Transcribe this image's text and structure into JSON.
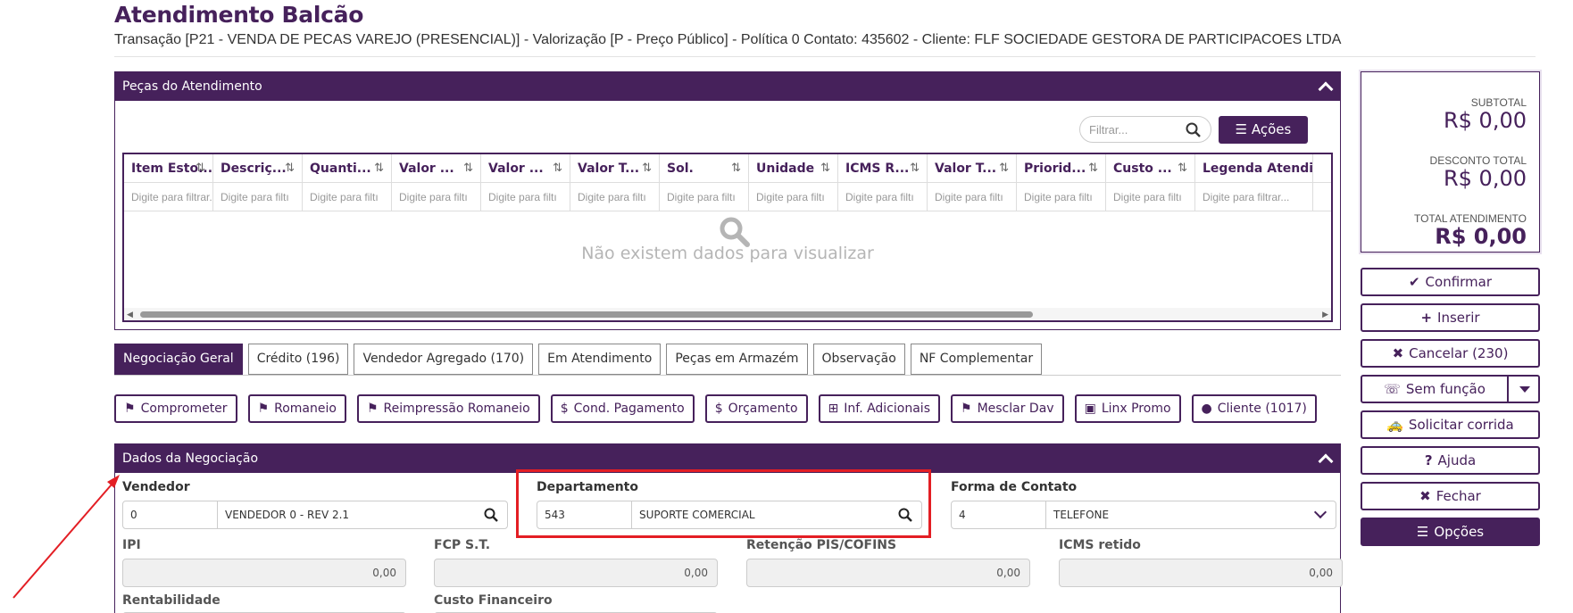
{
  "header": {
    "title": "Atendimento Balcão",
    "subtitle": "Transação [P21 - VENDA DE PECAS VAREJO (PRESENCIAL)] - Valorização [P - Preço Público] - Política 0 Contato: 435602 - Cliente: FLF SOCIEDADE GESTORA DE PARTICIPACOES LTDA"
  },
  "pecas": {
    "title": "Peças do Atendimento",
    "filter_placeholder": "Filtrar...",
    "acoes_label": "Ações",
    "columns": [
      "Item Esto...",
      "Descriç...",
      "Quanti...",
      "Valor ...",
      "Valor ...",
      "Valor T...",
      "Sol.",
      "Unidade",
      "ICMS R...",
      "Valor T...",
      "Priorid...",
      "Custo ...",
      "Legenda Atendime"
    ],
    "column_filters": [
      "Digite para filtrar...",
      "Digite para filtı",
      "Digite para filtı",
      "Digite para filtı",
      "Digite para filtı",
      "Digite para filtı",
      "Digite para filtı",
      "Digite para filtı",
      "Digite para filtı",
      "Digite para filtı",
      "Digite para filtı",
      "Digite para filtı",
      "Digite para filtrar..."
    ],
    "empty_text": "Não existem dados para visualizar"
  },
  "tabs": [
    "Negociação Geral",
    "Crédito (196)",
    "Vendedor Agregado (170)",
    "Em Atendimento",
    "Peças em Armazém",
    "Observação",
    "NF Complementar"
  ],
  "actions": [
    {
      "label": "Comprometer",
      "icon": "flag-icon"
    },
    {
      "label": "Romaneio",
      "icon": "flag-icon"
    },
    {
      "label": "Reimpressão Romaneio",
      "icon": "flag-icon"
    },
    {
      "label": "Cond. Pagamento",
      "icon": "dollar-icon"
    },
    {
      "label": "Orçamento",
      "icon": "dollar-icon"
    },
    {
      "label": "Inf. Adicionais",
      "icon": "plus-square-icon"
    },
    {
      "label": "Mesclar Dav",
      "icon": "flag-icon"
    },
    {
      "label": "Linx Promo",
      "icon": "money-icon"
    },
    {
      "label": "Cliente (1017)",
      "icon": "user-icon"
    }
  ],
  "dados": {
    "title": "Dados da Negociação",
    "vendedor_label": "Vendedor",
    "vendedor_code": "0",
    "vendedor_desc": "VENDEDOR 0 - REV 2.1",
    "departamento_label": "Departamento",
    "departamento_code": "543",
    "departamento_desc": "SUPORTE COMERCIAL",
    "forma_label": "Forma de Contato",
    "forma_code": "4",
    "forma_desc": "TELEFONE",
    "ipi_label": "IPI",
    "ipi_value": "0,00",
    "fcp_label": "FCP S.T.",
    "fcp_value": "0,00",
    "retencao_label": "Retenção PIS/COFINS",
    "retencao_value": "0,00",
    "icms_label": "ICMS retido",
    "icms_value": "0,00",
    "rentabilidade_label": "Rentabilidade",
    "custo_label": "Custo Financeiro"
  },
  "totals": {
    "subtotal_label": "SUBTOTAL",
    "subtotal_value": "R$ 0,00",
    "desconto_label": "DESCONTO TOTAL",
    "desconto_value": "R$ 0,00",
    "total_label": "TOTAL ATENDIMENTO",
    "total_value": "R$ 0,00"
  },
  "side_buttons": {
    "confirmar": "Confirmar",
    "inserir": "Inserir",
    "cancelar": "Cancelar (230)",
    "sem_funcao": "Sem função",
    "solicitar": "Solicitar corrida",
    "ajuda": "Ajuda",
    "fechar": "Fechar",
    "opcoes": "Opções"
  },
  "colors": {
    "brand": "#46215b",
    "highlight": "#e31e24"
  }
}
